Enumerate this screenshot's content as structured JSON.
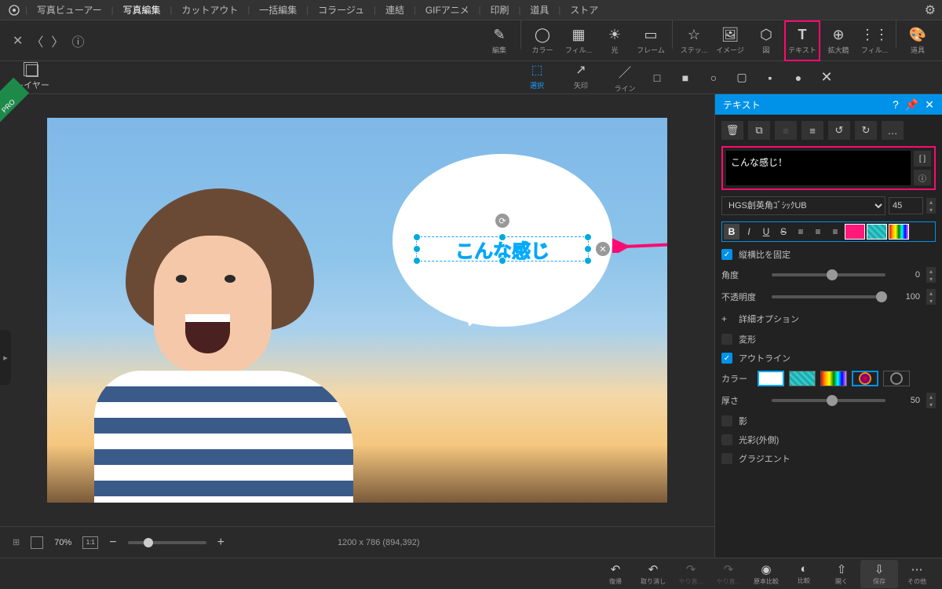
{
  "topbar": {
    "items": [
      "写真ビューアー",
      "写真編集",
      "カットアウト",
      "一括編集",
      "コラージュ",
      "連結",
      "GIFアニメ",
      "印刷",
      "道具",
      "ストア"
    ],
    "active": 1
  },
  "toolbar": [
    "編集",
    "カラー",
    "フィル...",
    "光",
    "フレーム",
    "ステッ...",
    "イメージ",
    "図",
    "テキスト",
    "拡大鏡",
    "フィル...",
    "道具"
  ],
  "layer_label": "レイヤー",
  "subtools": [
    "選択",
    "矢印",
    "ライン"
  ],
  "pro": "PRO",
  "text_on_image": "こんな感じ",
  "panel": {
    "title": "テキスト",
    "input": "こんな感じ！",
    "font": "HGS創英角ｺﾞｼｯｸUB",
    "size": "45",
    "lock_aspect": "縦横比を固定",
    "angle": {
      "label": "角度",
      "value": "0"
    },
    "opacity": {
      "label": "不透明度",
      "value": "100"
    },
    "advanced": "詳細オプション",
    "transform": "変形",
    "outline": "アウトライン",
    "color_label": "カラー",
    "thickness": {
      "label": "厚さ",
      "value": "50"
    },
    "shadow": "影",
    "glow": "光彩(外側)",
    "gradient": "グラジエント"
  },
  "status": {
    "zoom": "70%",
    "dims": "1200 x 786 (894,392)"
  },
  "bottombar": [
    "復帰",
    "取り消し",
    "やり直...",
    "やり直...",
    "原本比較",
    "比較",
    "開く",
    "保存",
    "その他"
  ]
}
